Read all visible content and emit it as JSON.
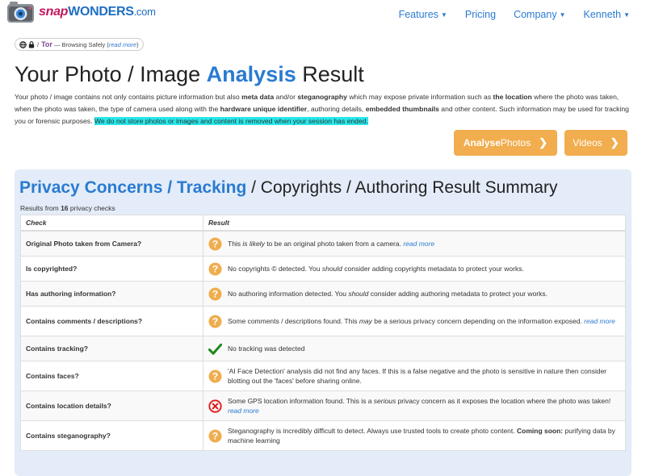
{
  "header": {
    "logo": {
      "snap": "snap",
      "wonders": "WONDERS",
      "dotcom": ".com"
    },
    "nav": [
      {
        "label": "Features",
        "dropdown": true
      },
      {
        "label": "Pricing",
        "dropdown": false
      },
      {
        "label": "Company",
        "dropdown": true
      },
      {
        "label": "Kenneth",
        "dropdown": true
      }
    ]
  },
  "safe_badge": {
    "tor": "Tor",
    "text": "— Browsing Safely (",
    "link": "read more",
    "close": ")"
  },
  "title": {
    "prefix": "Your Photo / Image ",
    "accent": "Analysis",
    "suffix": " Result"
  },
  "intro": {
    "p1": "Your photo / image contains not only contains picture information but also ",
    "b1": "meta data",
    "p2": " and/or ",
    "b2": "steganography",
    "p3": " which may expose private information such as ",
    "b3": "the location",
    "p4": " where the photo was taken, when the photo was taken, the type of camera used along with the ",
    "b4": "hardware unique identifier",
    "p5": ", authoring details, ",
    "b5": "embedded thumbnails",
    "p6": " and other content. Such information may be used for tracking you or forensic purposes. ",
    "highlight": "We do not store photos or images and content is removed when your session has ended."
  },
  "buttons": {
    "analyse_bold": "Analyse",
    "analyse_rest": " Photos",
    "videos": "Videos",
    "chevron": "❯"
  },
  "summary": {
    "title_accent": "Privacy Concerns / Tracking",
    "title_rest": " / Copyrights / Authoring Result Summary",
    "note_prefix": "Results from ",
    "note_count": "16",
    "note_suffix": " privacy checks",
    "col_check": "Check",
    "col_result": "Result",
    "colors": {
      "warning": "#f0ad4e",
      "ok": "#1b8a1b",
      "danger": "#e01b1b"
    },
    "rows": [
      {
        "check": "Original Photo taken from Camera?",
        "status": "warning-icon",
        "r1": "This ",
        "r2": "is likely",
        "r3": " to be an original photo taken from a camera. ",
        "link": "read more"
      },
      {
        "check": "Is copyrighted?",
        "status": "warning-icon",
        "r1": "No copyrights © detected. You ",
        "r2": "should",
        "r3": " consider adding copyrights metadata to protect your works.",
        "link": ""
      },
      {
        "check": "Has authoring information?",
        "status": "warning-icon",
        "r1": "No authoring information detected. You ",
        "r2": "should",
        "r3": " consider adding authoring metadata to protect your works.",
        "link": ""
      },
      {
        "check": "Contains comments / descriptions?",
        "status": "warning-icon",
        "r1": "Some comments / descriptions found. This ",
        "r2": "may",
        "r3": " be a serious privacy concern depending on the information exposed. ",
        "link": "read more"
      },
      {
        "check": "Contains tracking?",
        "status": "check-icon",
        "r1": "No tracking was detected",
        "r2": "",
        "r3": "",
        "link": ""
      },
      {
        "check": "Contains faces?",
        "status": "warning-icon",
        "r1": "'AI Face Detection' analysis did not find any faces. If this is a false negative and the photo is sensitive in nature then consider blotting out the 'faces' before sharing online.",
        "r2": "",
        "r3": "",
        "link": ""
      },
      {
        "check": "Contains location details?",
        "status": "danger-icon",
        "r1": "Some GPS location information found. This is a ",
        "r2": "serious",
        "r3": " privacy concern as it exposes the location where the photo was taken! ",
        "link": "read more"
      },
      {
        "check": "Contains steganography?",
        "status": "warning-icon",
        "r1": "Steganography is incredibly difficult to detect. Always use trusted tools to create photo content. ",
        "r2": "Coming soon:",
        "r3": " purifying data by machine learning",
        "link": ""
      }
    ]
  }
}
